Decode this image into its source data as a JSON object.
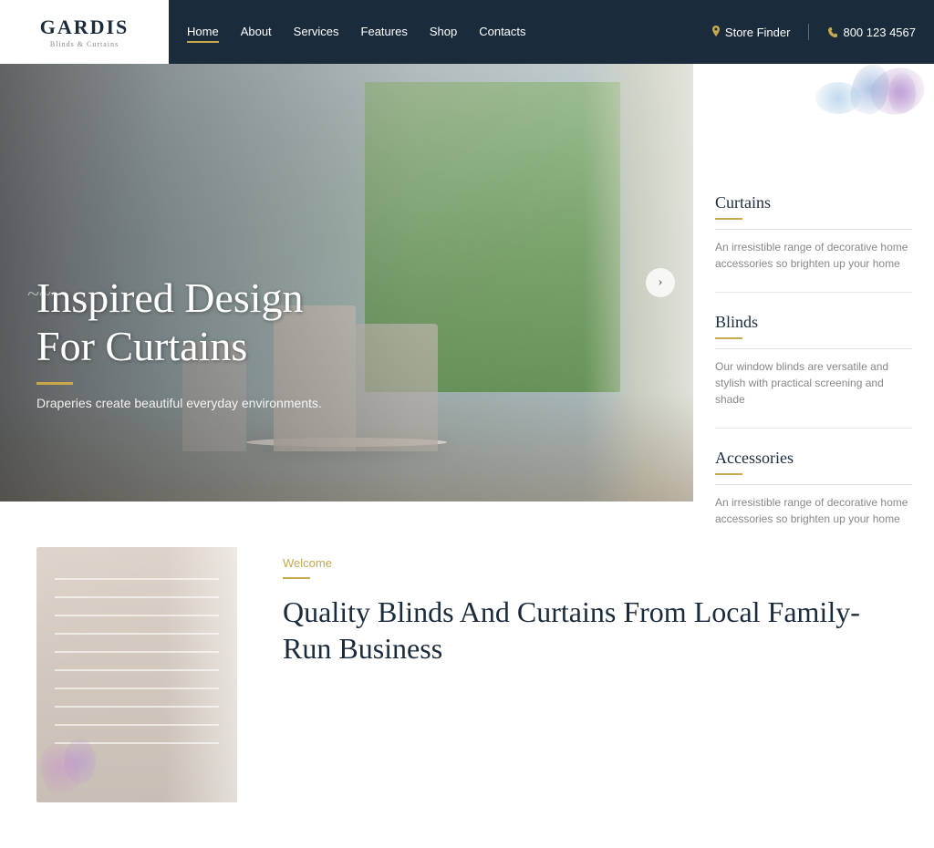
{
  "logo": {
    "name": "GARDIS",
    "subtitle": "Blinds & Curtains"
  },
  "navbar": {
    "links": [
      {
        "label": "Home",
        "active": true
      },
      {
        "label": "About",
        "active": false
      },
      {
        "label": "Services",
        "active": false
      },
      {
        "label": "Features",
        "active": false
      },
      {
        "label": "Shop",
        "active": false
      },
      {
        "label": "Contacts",
        "active": false
      }
    ],
    "store_finder": "Store Finder",
    "phone": "800 123 4567"
  },
  "hero": {
    "title": "Inspired Design\nFor Curtains",
    "subtitle": "Draperies create beautiful everyday environments.",
    "slider_btn": "›"
  },
  "sidebar": {
    "items": [
      {
        "title": "Curtains",
        "desc": "An irresistible range of decorative home accessories so brighten up your home"
      },
      {
        "title": "Blinds",
        "desc": "Our window blinds are versatile and stylish with practical screening and shade"
      },
      {
        "title": "Accessories",
        "desc": "An irresistible range of decorative home accessories so brighten up your home"
      }
    ]
  },
  "welcome": {
    "tag": "Welcome",
    "title": "Quality Blinds And Curtains From Local Family-Run Business"
  }
}
